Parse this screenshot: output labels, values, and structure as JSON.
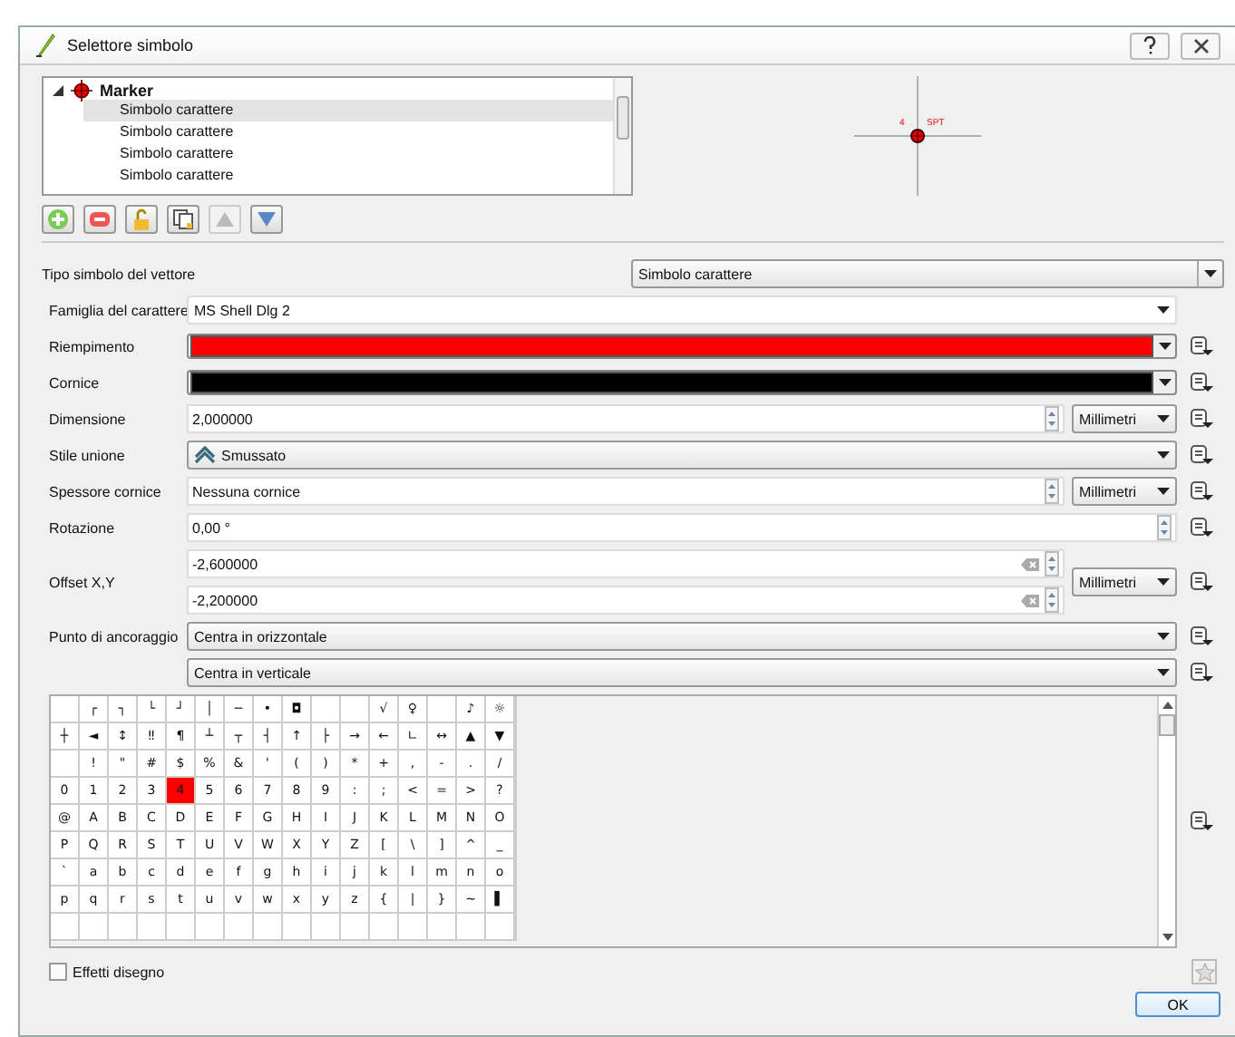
{
  "window": {
    "title": "Selettore simbolo"
  },
  "symbol_tree": {
    "root": {
      "label": "Marker",
      "expanded": true,
      "children": [
        {
          "label": "Simbolo carattere",
          "selected": true
        },
        {
          "label": "Simbolo carattere",
          "selected": false
        },
        {
          "label": "Simbolo carattere",
          "selected": false
        },
        {
          "label": "Simbolo carattere",
          "selected": false
        }
      ]
    }
  },
  "preview": {
    "labels": [
      "4",
      "SPT"
    ]
  },
  "layer_buttons": [
    {
      "kind": "add",
      "disabled": false
    },
    {
      "kind": "remove",
      "disabled": false
    },
    {
      "kind": "lock",
      "disabled": false
    },
    {
      "kind": "duplicate",
      "disabled": false
    },
    {
      "kind": "up",
      "disabled": true
    },
    {
      "kind": "down",
      "disabled": false
    }
  ],
  "symbol_layer_type": {
    "label": "Tipo simbolo del vettore",
    "value": "Simbolo carattere"
  },
  "properties": [
    {
      "kind": "combo",
      "label": "Famiglia del carattere",
      "value": "MS Shell Dlg 2",
      "data_defined": false
    },
    {
      "kind": "color",
      "label": "Riempimento",
      "color": "#ff0000",
      "data_defined": true
    },
    {
      "kind": "color",
      "label": "Cornice",
      "color": "#000000",
      "data_defined": true
    },
    {
      "kind": "spin",
      "label": "Dimensione",
      "value": "2,000000",
      "unit": "Millimetri",
      "data_defined": true
    },
    {
      "kind": "join",
      "label": "Stile unione",
      "value": "Smussato",
      "data_defined": true
    },
    {
      "kind": "spin",
      "label": "Spessore cornice",
      "value": "Nessuna cornice",
      "unit": "Millimetri",
      "data_defined": true
    },
    {
      "kind": "spin",
      "label": "Rotazione",
      "value": "0,00 °",
      "data_defined": true
    },
    {
      "kind": "offset",
      "label": "Offset X,Y",
      "values": [
        "-2,600000",
        "-2,200000"
      ],
      "unit": "Millimetri",
      "data_defined": true
    },
    {
      "kind": "combo",
      "label": "Punto di ancoraggio",
      "value": "Centra in orizzontale",
      "data_defined": true
    },
    {
      "kind": "combo",
      "value": "Centra in verticale",
      "data_defined": true
    }
  ],
  "character_grid": {
    "data_defined": true,
    "rows": [
      [
        null,
        {
          "char": "┌",
          "selected": false
        },
        {
          "char": "┐",
          "selected": false
        },
        {
          "char": "└",
          "selected": false
        },
        {
          "char": "┘",
          "selected": false
        },
        {
          "char": "│",
          "selected": false
        },
        {
          "char": "─",
          "selected": false
        },
        {
          "char": "•",
          "selected": false
        },
        {
          "char": "◘",
          "selected": false
        },
        null,
        null,
        {
          "char": "√",
          "selected": false
        },
        {
          "char": "♀",
          "selected": false
        },
        null,
        {
          "char": "♪",
          "selected": false
        },
        {
          "char": "☼",
          "selected": false
        }
      ],
      [
        {
          "char": "┼",
          "selected": false
        },
        {
          "char": "◄",
          "selected": false
        },
        {
          "char": "↕",
          "selected": false
        },
        {
          "char": "‼",
          "selected": false
        },
        {
          "char": "¶",
          "selected": false
        },
        {
          "char": "┴",
          "selected": false
        },
        {
          "char": "┬",
          "selected": false
        },
        {
          "char": "┤",
          "selected": false
        },
        {
          "char": "↑",
          "selected": false
        },
        {
          "char": "├",
          "selected": false
        },
        {
          "char": "→",
          "selected": false
        },
        {
          "char": "←",
          "selected": false
        },
        {
          "char": "∟",
          "selected": false
        },
        {
          "char": "↔",
          "selected": false
        },
        {
          "char": "▲",
          "selected": false
        },
        {
          "char": "▼",
          "selected": false
        }
      ],
      [
        null,
        {
          "char": "!",
          "selected": false
        },
        {
          "char": "\"",
          "selected": false
        },
        {
          "char": "#",
          "selected": false
        },
        {
          "char": "$",
          "selected": false
        },
        {
          "char": "%",
          "selected": false
        },
        {
          "char": "&",
          "selected": false
        },
        {
          "char": "'",
          "selected": false
        },
        {
          "char": "(",
          "selected": false
        },
        {
          "char": ")",
          "selected": false
        },
        {
          "char": "*",
          "selected": false
        },
        {
          "char": "+",
          "selected": false
        },
        {
          "char": ",",
          "selected": false
        },
        {
          "char": "-",
          "selected": false
        },
        {
          "char": ".",
          "selected": false
        },
        {
          "char": "/",
          "selected": false
        }
      ],
      [
        {
          "char": "0",
          "selected": false
        },
        {
          "char": "1",
          "selected": false
        },
        {
          "char": "2",
          "selected": false
        },
        {
          "char": "3",
          "selected": false
        },
        {
          "char": "4",
          "selected": true
        },
        {
          "char": "5",
          "selected": false
        },
        {
          "char": "6",
          "selected": false
        },
        {
          "char": "7",
          "selected": false
        },
        {
          "char": "8",
          "selected": false
        },
        {
          "char": "9",
          "selected": false
        },
        {
          "char": ":",
          "selected": false
        },
        {
          "char": ";",
          "selected": false
        },
        {
          "char": "<",
          "selected": false
        },
        {
          "char": "=",
          "selected": false
        },
        {
          "char": ">",
          "selected": false
        },
        {
          "char": "?",
          "selected": false
        }
      ],
      [
        {
          "char": "@",
          "selected": false
        },
        {
          "char": "A",
          "selected": false
        },
        {
          "char": "B",
          "selected": false
        },
        {
          "char": "C",
          "selected": false
        },
        {
          "char": "D",
          "selected": false
        },
        {
          "char": "E",
          "selected": false
        },
        {
          "char": "F",
          "selected": false
        },
        {
          "char": "G",
          "selected": false
        },
        {
          "char": "H",
          "selected": false
        },
        {
          "char": "I",
          "selected": false
        },
        {
          "char": "J",
          "selected": false
        },
        {
          "char": "K",
          "selected": false
        },
        {
          "char": "L",
          "selected": false
        },
        {
          "char": "M",
          "selected": false
        },
        {
          "char": "N",
          "selected": false
        },
        {
          "char": "O",
          "selected": false
        }
      ],
      [
        {
          "char": "P",
          "selected": false
        },
        {
          "char": "Q",
          "selected": false
        },
        {
          "char": "R",
          "selected": false
        },
        {
          "char": "S",
          "selected": false
        },
        {
          "char": "T",
          "selected": false
        },
        {
          "char": "U",
          "selected": false
        },
        {
          "char": "V",
          "selected": false
        },
        {
          "char": "W",
          "selected": false
        },
        {
          "char": "X",
          "selected": false
        },
        {
          "char": "Y",
          "selected": false
        },
        {
          "char": "Z",
          "selected": false
        },
        {
          "char": "[",
          "selected": false
        },
        {
          "char": "\\",
          "selected": false
        },
        {
          "char": "]",
          "selected": false
        },
        {
          "char": "^",
          "selected": false
        },
        {
          "char": "_",
          "selected": false
        }
      ],
      [
        {
          "char": "`",
          "selected": false
        },
        {
          "char": "a",
          "selected": false
        },
        {
          "char": "b",
          "selected": false
        },
        {
          "char": "c",
          "selected": false
        },
        {
          "char": "d",
          "selected": false
        },
        {
          "char": "e",
          "selected": false
        },
        {
          "char": "f",
          "selected": false
        },
        {
          "char": "g",
          "selected": false
        },
        {
          "char": "h",
          "selected": false
        },
        {
          "char": "i",
          "selected": false
        },
        {
          "char": "j",
          "selected": false
        },
        {
          "char": "k",
          "selected": false
        },
        {
          "char": "l",
          "selected": false
        },
        {
          "char": "m",
          "selected": false
        },
        {
          "char": "n",
          "selected": false
        },
        {
          "char": "o",
          "selected": false
        }
      ],
      [
        {
          "char": "p",
          "selected": false
        },
        {
          "char": "q",
          "selected": false
        },
        {
          "char": "r",
          "selected": false
        },
        {
          "char": "s",
          "selected": false
        },
        {
          "char": "t",
          "selected": false
        },
        {
          "char": "u",
          "selected": false
        },
        {
          "char": "v",
          "selected": false
        },
        {
          "char": "w",
          "selected": false
        },
        {
          "char": "x",
          "selected": false
        },
        {
          "char": "y",
          "selected": false
        },
        {
          "char": "z",
          "selected": false
        },
        {
          "char": "{",
          "selected": false
        },
        {
          "char": "|",
          "selected": false
        },
        {
          "char": "}",
          "selected": false
        },
        {
          "char": "~",
          "selected": false
        },
        {
          "char": "▌",
          "selected": false
        }
      ],
      [
        null,
        null,
        null,
        null,
        null,
        null,
        null,
        null,
        null,
        null,
        null,
        null,
        null,
        null,
        null,
        null
      ]
    ]
  },
  "draw_effects": {
    "label": "Effetti disegno",
    "checked": false
  },
  "ok_button": "OK"
}
